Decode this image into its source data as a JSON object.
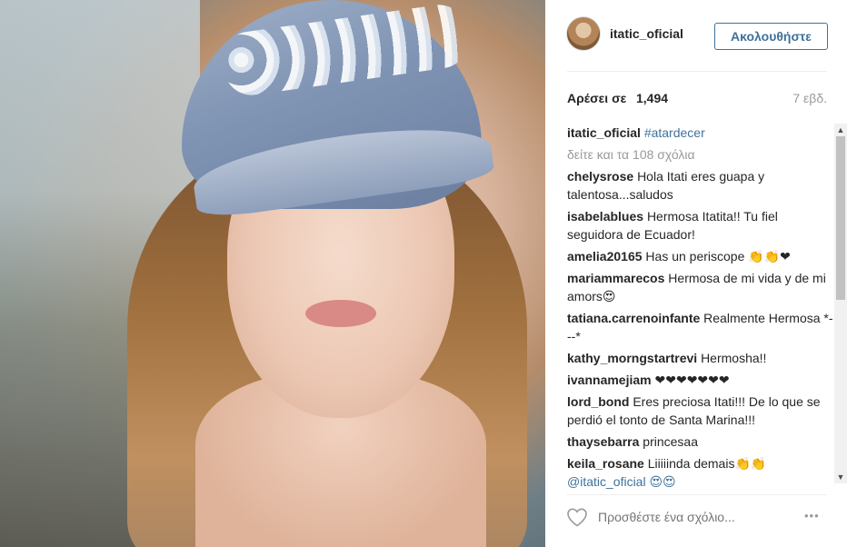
{
  "post": {
    "username": "itatic_oficial",
    "follow_label": "Ακολουθήστε",
    "likes_label": "Αρέσει σε",
    "likes_count": "1,494",
    "age": "7 εβδ.",
    "caption": {
      "user": "itatic_oficial",
      "hashtag": "#atardecer"
    },
    "view_all": "δείτε και τα 108 σχόλια",
    "comments": [
      {
        "user": "chelysrose",
        "text": "Hola Itati eres guapa y talentosa...saludos"
      },
      {
        "user": "isabelablues",
        "text": "Hermosa Itatita!! Tu fiel seguidora de Ecuador!"
      },
      {
        "user": "amelia20165",
        "text": "Has un periscope 👏👏❤"
      },
      {
        "user": "mariammarecos",
        "text": "Hermosa de mi vida y de mi amors😍"
      },
      {
        "user": "tatiana.carrenoinfante",
        "text": "Realmente Hermosa *---*"
      },
      {
        "user": "kathy_morngstartrevi",
        "text": "Hermosha!!"
      },
      {
        "user": "ivannamejiam",
        "text": "❤❤❤❤❤❤❤"
      },
      {
        "user": "lord_bond",
        "text": "Eres preciosa Itati!!! De lo que se perdió el tonto de Santa Marina!!!"
      },
      {
        "user": "thaysebarra",
        "text": "princesaa"
      },
      {
        "user": "keila_rosane",
        "text": "Liiiiinda demais👏👏",
        "mention": "@itatic_oficial 😍😍"
      }
    ],
    "comment_placeholder": "Προσθέστε ένα σχόλιο...",
    "more_icon": "•••"
  },
  "colors": {
    "link": "#3f729b",
    "muted": "#999999"
  }
}
